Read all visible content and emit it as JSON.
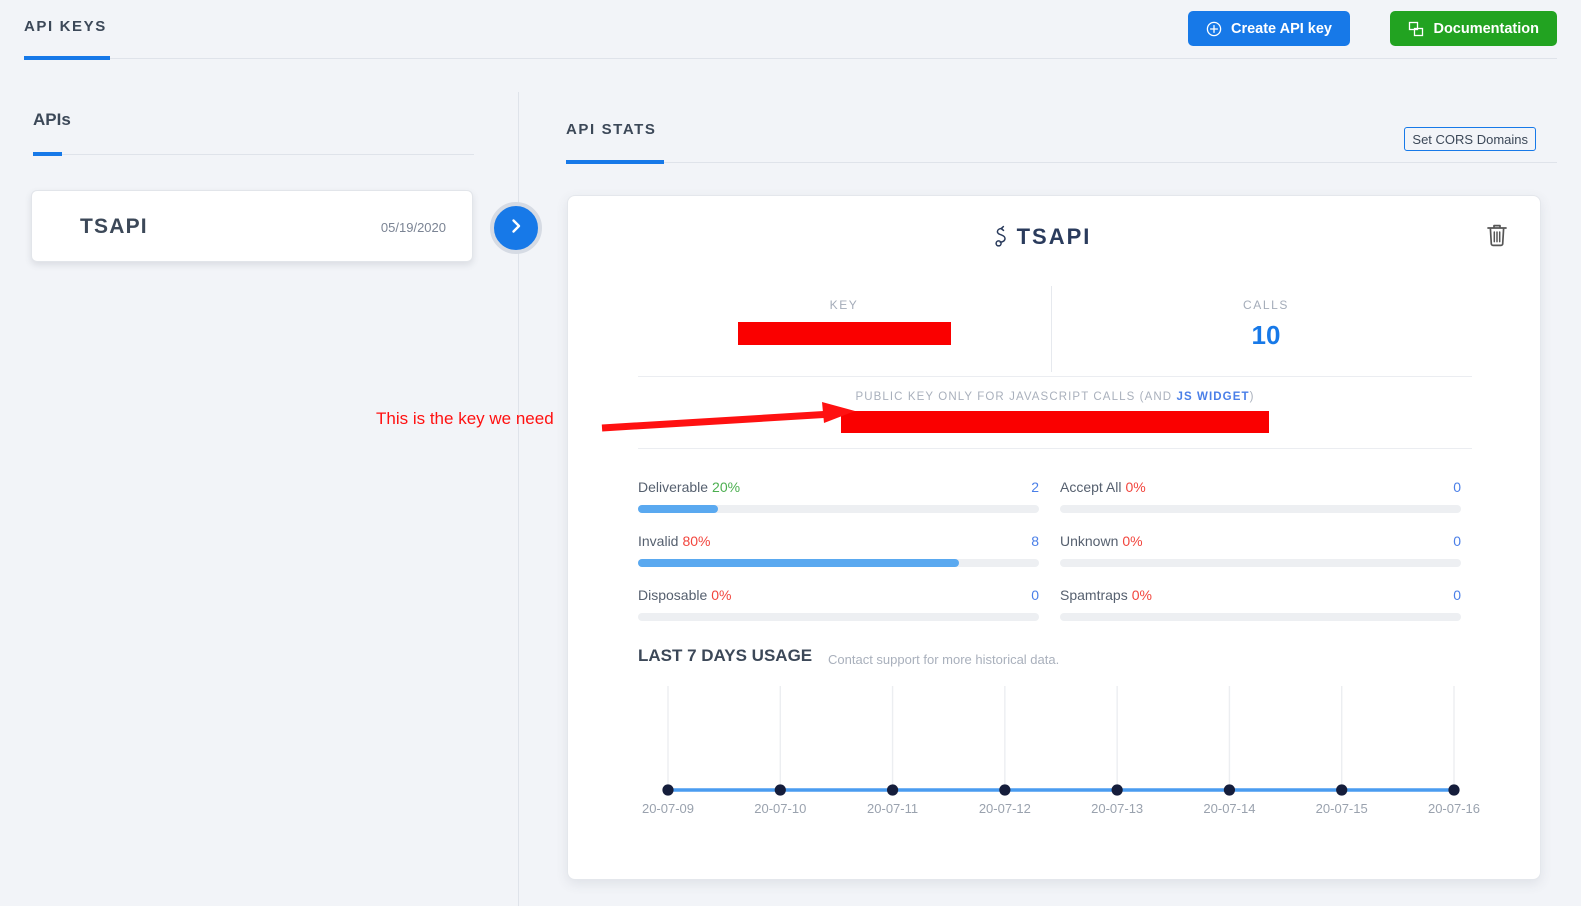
{
  "topbar": {
    "title": "API KEYS",
    "create_button": "Create API key",
    "create_icon": "plus-circle-icon",
    "docs_button": "Documentation",
    "docs_icon": "window-copy-icon",
    "accent_color": "#1779e8",
    "docs_color": "#22a321"
  },
  "left_panel": {
    "heading": "APIs",
    "api_card": {
      "name": "TSAPI",
      "date": "05/19/2020"
    },
    "next_arrow_icon": "chevron-right-icon"
  },
  "right_panel": {
    "heading": "API STATS",
    "cors_button": "Set CORS Domains",
    "card": {
      "title": "TSAPI",
      "title_icon": "api-route-icon",
      "delete_icon": "trash-icon",
      "key_label": "KEY",
      "key_value": "",
      "key_redacted": true,
      "calls_label": "CALLS",
      "calls_value": "10",
      "public_key_label_prefix": "PUBLIC KEY ONLY FOR JAVASCRIPT CALLS (AND ",
      "public_key_label_link": "JS WIDGET",
      "public_key_label_suffix": ")",
      "public_key_value": "",
      "public_key_redacted": true,
      "stats": [
        {
          "label": "Deliverable",
          "percent": "20%",
          "percent_tone": "good",
          "count": "2",
          "fill": 20
        },
        {
          "label": "Accept All",
          "percent": "0%",
          "percent_tone": "bad",
          "count": "0",
          "fill": 0
        },
        {
          "label": "Invalid",
          "percent": "80%",
          "percent_tone": "bad",
          "count": "8",
          "fill": 80
        },
        {
          "label": "Unknown",
          "percent": "0%",
          "percent_tone": "bad",
          "count": "0",
          "fill": 0
        },
        {
          "label": "Disposable",
          "percent": "0%",
          "percent_tone": "bad",
          "count": "0",
          "fill": 0
        },
        {
          "label": "Spamtraps",
          "percent": "0%",
          "percent_tone": "bad",
          "count": "0",
          "fill": 0
        }
      ],
      "chart_heading": "LAST 7 DAYS USAGE",
      "chart_subtext": "Contact support for more historical data."
    }
  },
  "annotation": {
    "text": "This is the key we need",
    "color": "#ff1111"
  },
  "chart_data": {
    "type": "line",
    "title": "LAST 7 DAYS USAGE",
    "subtitle": "Contact support for more historical data.",
    "xlabel": "",
    "ylabel": "",
    "categories": [
      "20-07-09",
      "20-07-10",
      "20-07-11",
      "20-07-12",
      "20-07-13",
      "20-07-14",
      "20-07-15",
      "20-07-16"
    ],
    "series": [
      {
        "name": "Usage",
        "values": [
          0,
          0,
          0,
          0,
          0,
          0,
          0,
          0
        ]
      }
    ],
    "ylim": [
      0,
      1
    ],
    "grid": "vertical",
    "legend": "none",
    "line_color": "#4a9cf0",
    "marker_color": "#151d3b"
  }
}
